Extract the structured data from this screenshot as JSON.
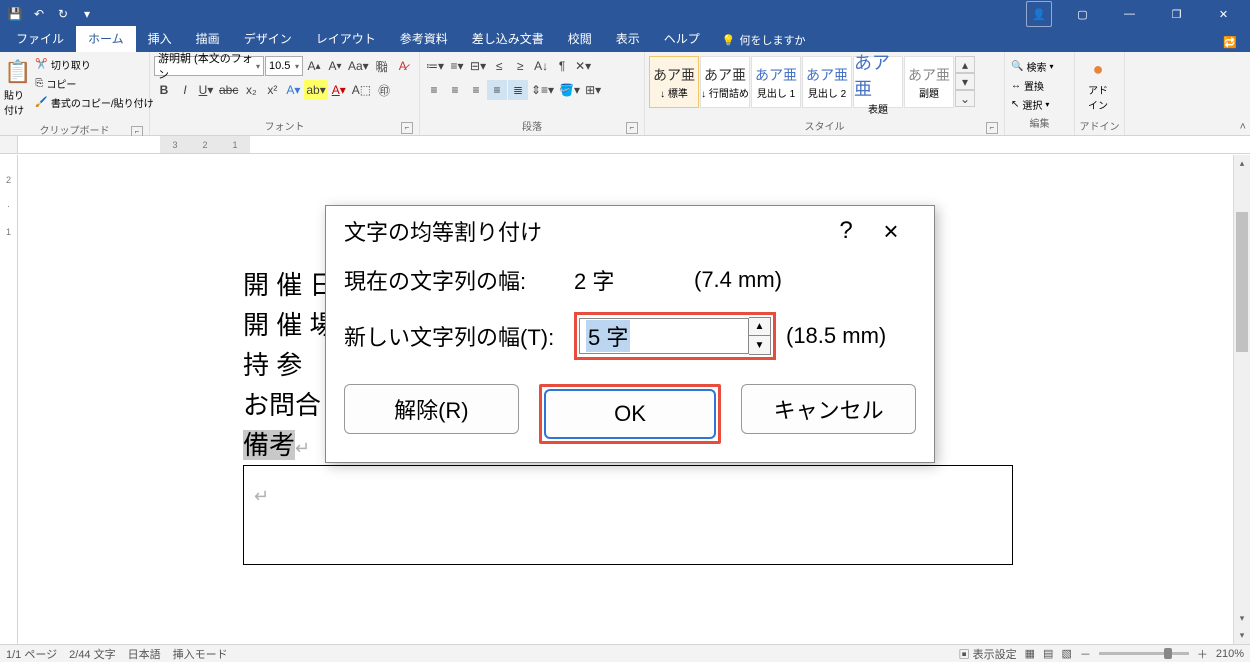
{
  "titlebar": {
    "qat": {
      "save": "💾",
      "undo": "↶",
      "redo": "↻",
      "more": "▾"
    }
  },
  "tabs": {
    "file": "ファイル",
    "home": "ホーム",
    "insert": "挿入",
    "draw": "描画",
    "design": "デザイン",
    "layout": "レイアウト",
    "references": "参考資料",
    "mail": "差し込み文書",
    "review": "校閲",
    "view": "表示",
    "help": "ヘルプ",
    "tell_icon": "💡",
    "tell": "何をしますか"
  },
  "ribbon": {
    "clipboard": {
      "paste": "貼り付け",
      "cut": "切り取り",
      "copy": "コピー",
      "fmtpainter": "書式のコピー/貼り付け",
      "label": "クリップボード"
    },
    "font": {
      "name": "游明朝 (本文のフォン",
      "size": "10.5",
      "label": "フォント"
    },
    "paragraph": {
      "label": "段落"
    },
    "styles": {
      "label": "スタイル",
      "items": [
        {
          "prev": "あア亜",
          "name": "↓ 標準"
        },
        {
          "prev": "あア亜",
          "name": "↓ 行間詰め"
        },
        {
          "prev": "あア亜",
          "name": "見出し 1"
        },
        {
          "prev": "あア亜",
          "name": "見出し 2"
        },
        {
          "prev": "あア亜",
          "name": "表題"
        },
        {
          "prev": "あア亜",
          "name": "副題"
        }
      ]
    },
    "editing": {
      "find": "検索",
      "replace": "置換",
      "select": "選択",
      "label": "編集"
    },
    "addins": {
      "btn": "アド\nイン",
      "label": "アドイン"
    }
  },
  "document": {
    "lines": [
      "開 催 日",
      "開 催 場",
      "持  参",
      "お問合"
    ],
    "selected": "備考",
    "return": "↵"
  },
  "dialog": {
    "title": "文字の均等割り付け",
    "current_label": "現在の文字列の幅:",
    "current_chars": "2 字",
    "current_mm": "(7.4 mm)",
    "new_label": "新しい文字列の幅(T):",
    "new_value": "5 字",
    "new_mm": "(18.5 mm)",
    "btn_release": "解除(R)",
    "btn_ok": "OK",
    "btn_cancel": "キャンセル",
    "help": "?",
    "close": "×"
  },
  "statusbar": {
    "page": "1/1 ページ",
    "words": "2/44 文字",
    "lang": "日本語",
    "mode": "挿入モード",
    "display": "表示設定",
    "zoom": "210%",
    "plus": "＋",
    "minus": "－"
  },
  "ruler_start": [
    "3",
    "2",
    "1"
  ]
}
